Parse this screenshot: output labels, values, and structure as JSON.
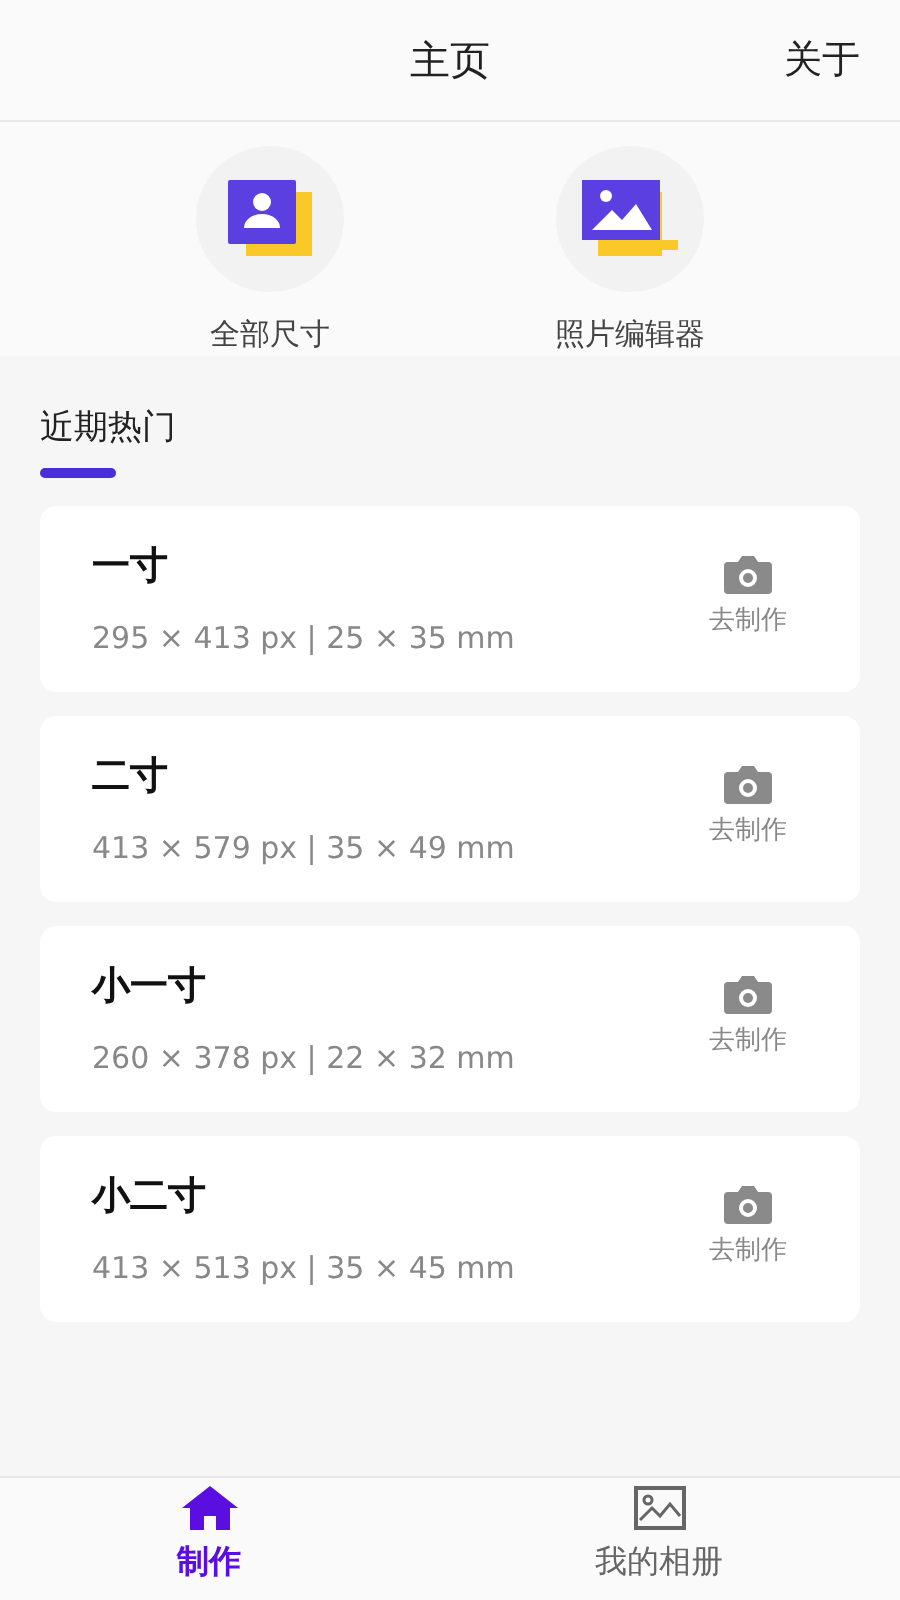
{
  "header": {
    "title": "主页",
    "action": "关于"
  },
  "shortcuts": [
    {
      "kind": "person",
      "label": "全部尺寸"
    },
    {
      "kind": "landscape",
      "label": "照片编辑器"
    }
  ],
  "section": {
    "title": "近期热门"
  },
  "sizes": [
    {
      "name": "一寸",
      "spec": "295 × 413 px | 25 × 35 mm",
      "action": "去制作"
    },
    {
      "name": "二寸",
      "spec": "413 × 579 px | 35 × 49 mm",
      "action": "去制作"
    },
    {
      "name": "小一寸",
      "spec": "260 × 378 px | 22 × 32 mm",
      "action": "去制作"
    },
    {
      "name": "小二寸",
      "spec": "413 × 513 px | 35 × 45 mm",
      "action": "去制作"
    }
  ],
  "bottom_nav": [
    {
      "kind": "home",
      "label": "制作",
      "selected": true
    },
    {
      "kind": "album",
      "label": "我的相册",
      "selected": false
    }
  ]
}
